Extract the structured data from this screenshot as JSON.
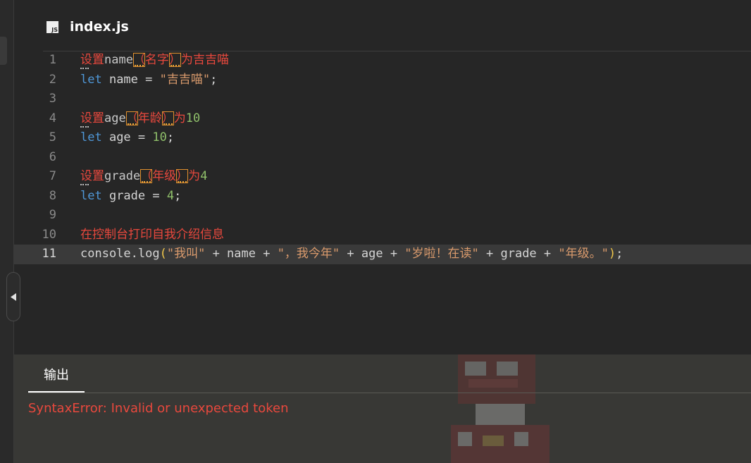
{
  "file": {
    "icon_label": "JS",
    "name": "index.js"
  },
  "lines": [
    {
      "no": "1",
      "parts": [
        {
          "t": "设置",
          "c": "cm-err"
        },
        {
          "t": "name",
          "c": "cm-txt"
        },
        {
          "t": "（",
          "c": "cm-red",
          "box": true
        },
        {
          "t": "名字",
          "c": "cm-red"
        },
        {
          "t": "）",
          "c": "cm-red",
          "box": true
        },
        {
          "t": "为吉吉喵",
          "c": "cm-red"
        }
      ],
      "dots": true
    },
    {
      "no": "2",
      "parts": [
        {
          "t": "let",
          "c": "cm-kw"
        },
        {
          "t": " name = ",
          "c": "cm-op"
        },
        {
          "t": "\"吉吉喵\"",
          "c": "cm-str"
        },
        {
          "t": ";",
          "c": "cm-op"
        }
      ]
    },
    {
      "no": "3",
      "parts": []
    },
    {
      "no": "4",
      "parts": [
        {
          "t": "设置",
          "c": "cm-err"
        },
        {
          "t": "age",
          "c": "cm-txt"
        },
        {
          "t": "（",
          "c": "cm-red",
          "box": true
        },
        {
          "t": "年龄",
          "c": "cm-red"
        },
        {
          "t": "）",
          "c": "cm-red",
          "box": true
        },
        {
          "t": "为",
          "c": "cm-red"
        },
        {
          "t": "10",
          "c": "cm-num"
        }
      ],
      "dots": true
    },
    {
      "no": "5",
      "parts": [
        {
          "t": "let",
          "c": "cm-kw"
        },
        {
          "t": " age = ",
          "c": "cm-op"
        },
        {
          "t": "10",
          "c": "cm-num"
        },
        {
          "t": ";",
          "c": "cm-op"
        }
      ]
    },
    {
      "no": "6",
      "parts": []
    },
    {
      "no": "7",
      "parts": [
        {
          "t": "设置",
          "c": "cm-err"
        },
        {
          "t": "grade",
          "c": "cm-txt"
        },
        {
          "t": "（",
          "c": "cm-red",
          "box": true
        },
        {
          "t": "年级",
          "c": "cm-red"
        },
        {
          "t": "）",
          "c": "cm-red",
          "box": true
        },
        {
          "t": "为",
          "c": "cm-red"
        },
        {
          "t": "4",
          "c": "cm-num"
        }
      ],
      "dots": true
    },
    {
      "no": "8",
      "parts": [
        {
          "t": "let",
          "c": "cm-kw"
        },
        {
          "t": " grade = ",
          "c": "cm-op"
        },
        {
          "t": "4",
          "c": "cm-num"
        },
        {
          "t": ";",
          "c": "cm-op"
        }
      ]
    },
    {
      "no": "9",
      "parts": []
    },
    {
      "no": "10",
      "parts": [
        {
          "t": "在控制台打印自我介绍信息",
          "c": "cm-red"
        }
      ]
    },
    {
      "no": "11",
      "active": true,
      "parts": [
        {
          "t": "console.log",
          "c": "cm-op"
        },
        {
          "t": "(",
          "c": "cm-paren"
        },
        {
          "t": "\"我叫\"",
          "c": "cm-str"
        },
        {
          "t": " + name + ",
          "c": "cm-op"
        },
        {
          "t": "\"，我今年\"",
          "c": "cm-str"
        },
        {
          "t": " + age + ",
          "c": "cm-op"
        },
        {
          "t": "\"岁啦！在读\"",
          "c": "cm-str"
        },
        {
          "t": " + grade + ",
          "c": "cm-op"
        },
        {
          "t": "\"年级。\"",
          "c": "cm-str"
        },
        {
          "t": ")",
          "c": "cm-paren"
        },
        {
          "t": ";",
          "c": "cm-op"
        }
      ]
    }
  ],
  "output": {
    "tab_label": "输出",
    "message": "SyntaxError: Invalid or unexpected token"
  },
  "colors": {
    "error": "#e8483d",
    "keyword": "#4f97d7",
    "string": "#d99a6c",
    "number": "#8fbf6a",
    "paren": "#f0c64a"
  }
}
